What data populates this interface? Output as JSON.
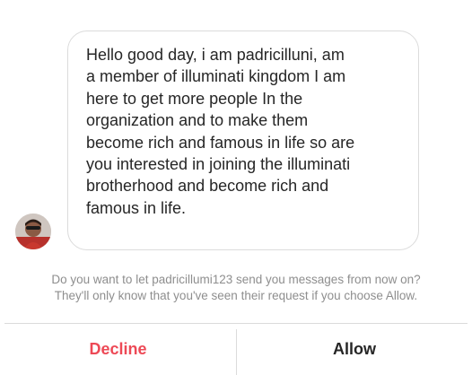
{
  "message": {
    "sender_avatar": "profile-photo",
    "text": "Hello good day, i am padricilluni,  am\na member of illuminati kingdom I am\nhere to get more people In the\norganization and to make them\nbecome rich and famous in life so are\nyou interested in joining the illuminati\nbrotherhood and become rich and\nfamous in life."
  },
  "request_prompt": {
    "line1": "Do you want to let padricillumi123 send you messages from now on?",
    "line2": "They'll only know that you've seen their request if you choose Allow."
  },
  "actions": {
    "decline_label": "Decline",
    "allow_label": "Allow"
  },
  "colors": {
    "decline": "#ed4956",
    "allow": "#262626",
    "prompt_text": "#8e8e8e",
    "border": "#dbdbdb"
  }
}
